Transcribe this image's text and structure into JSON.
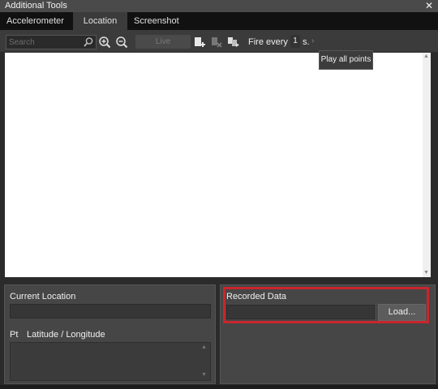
{
  "window": {
    "title": "Additional Tools",
    "close_glyph": "✕"
  },
  "tabs": [
    {
      "label": "Accelerometer"
    },
    {
      "label": "Location"
    },
    {
      "label": "Screenshot"
    }
  ],
  "toolbar": {
    "search_placeholder": "Search",
    "live_label": "Live",
    "fire_label": "Fire every",
    "fire_value": "1",
    "fire_unit": "s.",
    "fire_chevron": "›",
    "tooltip": "Play all points"
  },
  "location": {
    "current_label": "Current Location",
    "pt_label": "Pt",
    "latlon_label": "Latitude / Longitude"
  },
  "recorded": {
    "label": "Recorded Data",
    "load_label": "Load..."
  },
  "colors": {
    "highlight": "#c9252c"
  }
}
